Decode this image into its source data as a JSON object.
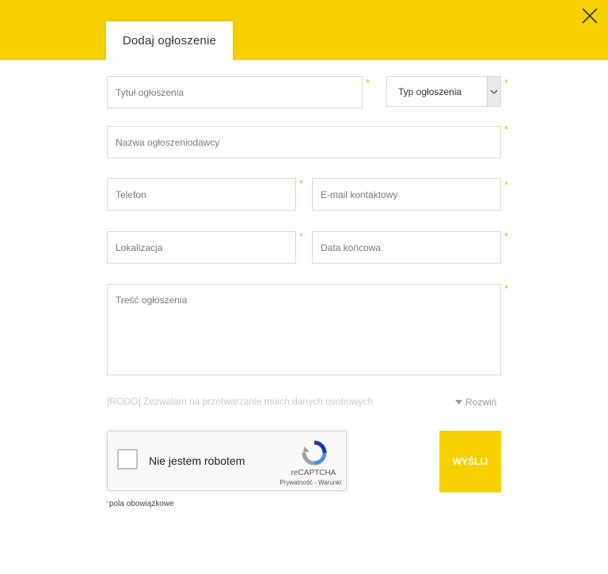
{
  "header": {
    "tab_label": "Dodaj ogłoszenie",
    "close_icon": "close-icon",
    "accent_color": "#f7d000"
  },
  "form": {
    "title_placeholder": "Tytuł ogłoszenia",
    "type_select_value": "Typ ogłoszenia",
    "advertiser_placeholder": "Nazwa ogłoszeniodawcy",
    "phone_placeholder": "Telefon",
    "email_placeholder": "E-mail kontaktowy",
    "location_placeholder": "Lokalizacja",
    "end_date_placeholder": "Data końcowa",
    "content_placeholder": "Treść ogłoszenia",
    "required_marker": "*",
    "rodo_text": "[RODO] Zezwalam na przetwarzanie moich danych osobowych",
    "expand_label": "Rozwiń",
    "submit_label": "WYŚLIJ",
    "required_note": "pola obowiązkowe"
  },
  "captcha": {
    "checkbox_label": "Nie jestem robotem",
    "brand": "reCAPTCHA",
    "links": "Prywatność - Warunki"
  }
}
